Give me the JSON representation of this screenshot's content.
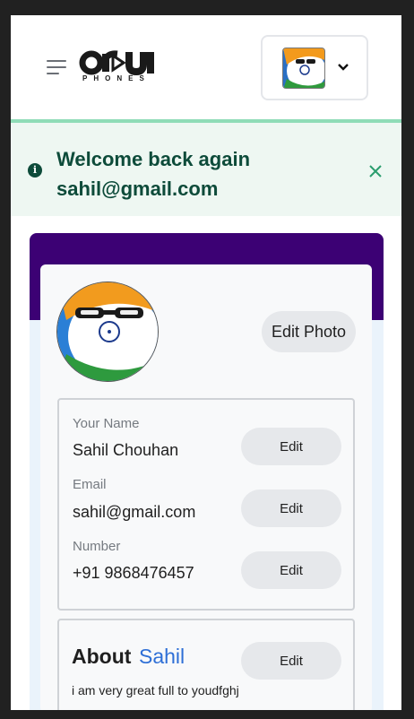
{
  "header": {
    "logo_alt": "oru PHONES",
    "logo_sub": "PHONES"
  },
  "alert": {
    "message": "Welcome back again sahil@gmail.com"
  },
  "profile": {
    "edit_photo_label": "Edit Photo",
    "fields": [
      {
        "label": "Your Name",
        "value": "Sahil Chouhan",
        "edit_label": "Edit"
      },
      {
        "label": "Email",
        "value": "sahil@gmail.com",
        "edit_label": "Edit"
      },
      {
        "label": "Number",
        "value": "+91 9868476457",
        "edit_label": "Edit"
      }
    ],
    "about": {
      "title": "About",
      "name": "Sahil",
      "text": "i am very great full to youdfghj",
      "edit_label": "Edit"
    }
  },
  "colors": {
    "alert_text": "#0d4b3a",
    "card_header": "#3c0174",
    "accent_name": "#2e6fd6",
    "header_border": "#8fdcb7"
  }
}
